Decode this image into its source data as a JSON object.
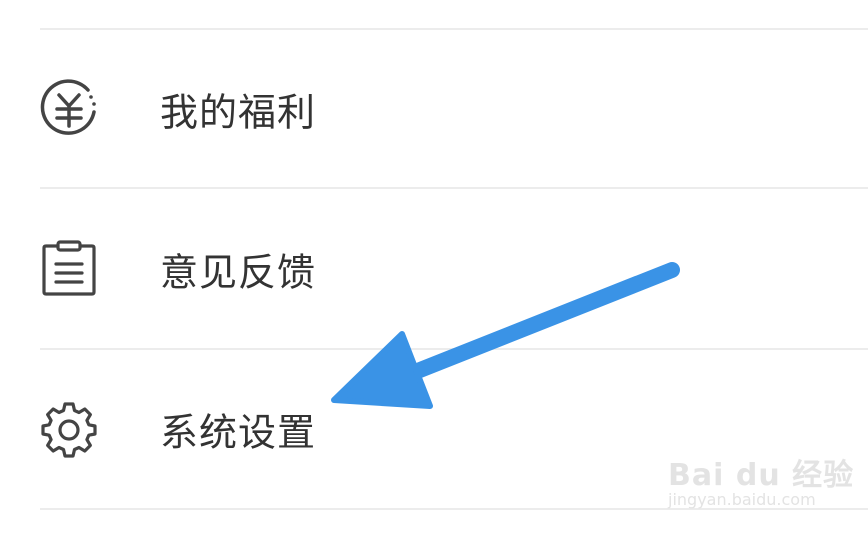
{
  "menu": {
    "items": [
      {
        "label": "我的福利",
        "icon": "yuan-coin-icon"
      },
      {
        "label": "意见反馈",
        "icon": "clipboard-icon"
      },
      {
        "label": "系统设置",
        "icon": "gear-icon"
      }
    ]
  },
  "annotation": {
    "arrow_color": "#3a93e6",
    "arrow_icon": "pointer-arrow-icon"
  },
  "watermark": {
    "main": "Bai du 经验",
    "sub": "jingyan.baidu.com"
  },
  "colors": {
    "text": "#333333",
    "icon": "#444444",
    "divider": "#ececec",
    "background": "#ffffff"
  }
}
